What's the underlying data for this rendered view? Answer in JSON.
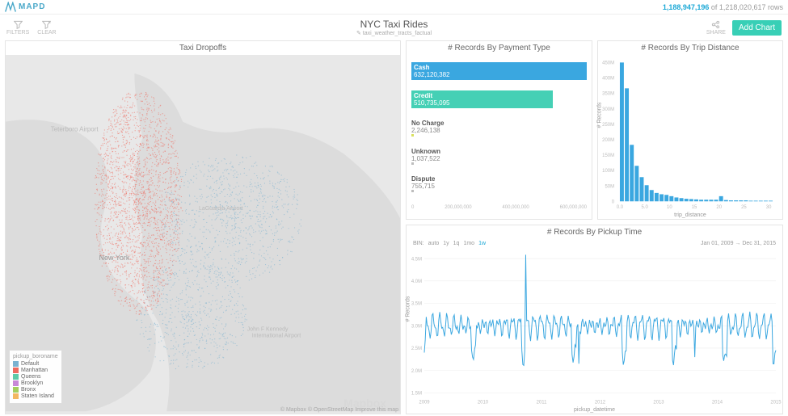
{
  "brand": "MAPD",
  "rowcount": {
    "current": "1,188,947,196",
    "total": "1,218,020,617",
    "suffix": "rows"
  },
  "tools": {
    "filters": "FILTERS",
    "clear": "CLEAR",
    "share": "SHARE",
    "addchart": "Add Chart"
  },
  "title": "NYC Taxi Rides",
  "subtitle": "taxi_weather_tracts_factual",
  "map": {
    "title": "Taxi Dropoffs",
    "legend_title": "pickup_boroname",
    "legend": [
      {
        "label": "Default",
        "color": "#7bb3d1"
      },
      {
        "label": "Manhattan",
        "color": "#ef6a5f"
      },
      {
        "label": "Queens",
        "color": "#5fc9a8"
      },
      {
        "label": "Brooklyn",
        "color": "#c888d8"
      },
      {
        "label": "Bronx",
        "color": "#a4cf5f"
      },
      {
        "label": "Staten Island",
        "color": "#f3b861"
      }
    ],
    "attrib1": "© Mapbox",
    "attrib2": "© OpenStreetMap",
    "attrib3": "Improve this map",
    "wm": "Mapbox",
    "labels": {
      "ny": "New York",
      "ta": "Teterboro Airport",
      "lga": "LaGuardia Airport",
      "jfk": "John F Kennedy International Airport"
    }
  },
  "chart_data": [
    {
      "type": "bar",
      "title": "# Records By Payment Type",
      "orientation": "horizontal",
      "xlabel": "",
      "ylabel": "",
      "xlim": [
        0,
        650000000
      ],
      "categories": [
        "Cash",
        "Credit",
        "No Charge",
        "Unknown",
        "Dispute"
      ],
      "values": [
        632120382,
        510735095,
        2246138,
        1037522,
        755715
      ],
      "labels": [
        "632,120,382",
        "510,735,095",
        "2,246,138",
        "1,037,522",
        "755,715"
      ],
      "colors": [
        "#3aa7e0",
        "#45d0b5",
        "#d9e05f",
        "#bdbdbd",
        "#bdbdbd"
      ],
      "xticks": [
        "0",
        "200,000,000",
        "400,000,000",
        "600,000,000"
      ]
    },
    {
      "type": "bar",
      "title": "# Records By Trip Distance",
      "xlabel": "trip_distance",
      "ylabel": "# Records",
      "ylim": [
        0,
        450000000
      ],
      "categories": [
        0,
        1,
        2,
        3,
        4,
        5,
        6,
        7,
        8,
        9,
        10,
        11,
        12,
        13,
        14,
        15,
        16,
        17,
        18,
        19,
        20,
        21,
        22,
        23,
        24,
        25,
        26,
        27,
        28,
        29,
        30
      ],
      "values": [
        430,
        350,
        175,
        110,
        75,
        50,
        35,
        26,
        22,
        20,
        16,
        12,
        10,
        8,
        7,
        6,
        5,
        5,
        5,
        5,
        16,
        4,
        3,
        3,
        3,
        3,
        2,
        2,
        2,
        2,
        2
      ],
      "yticks": [
        "0",
        "50M",
        "100M",
        "150M",
        "200M",
        "250M",
        "300M",
        "350M",
        "400M",
        "450M"
      ],
      "xticks": [
        "0.0",
        "5.0",
        "10",
        "15",
        "20",
        "25",
        "30"
      ]
    },
    {
      "type": "line",
      "title": "# Records By Pickup Time",
      "xlabel": "pickup_datetime",
      "ylabel": "# Records",
      "bin_label": "BIN:",
      "bin_options": [
        "auto",
        "1y",
        "1q",
        "1mo",
        "1w"
      ],
      "bin_active": "1w",
      "date_range": "Jan 01, 2009  →  Dec 31, 2015",
      "yticks": [
        "1.5M",
        "2.0M",
        "2.5M",
        "3.0M",
        "3.5M",
        "4.0M",
        "4.5M"
      ],
      "xticks": [
        "2009",
        "2010",
        "2011",
        "2012",
        "2013",
        "2014",
        "2015"
      ]
    }
  ]
}
